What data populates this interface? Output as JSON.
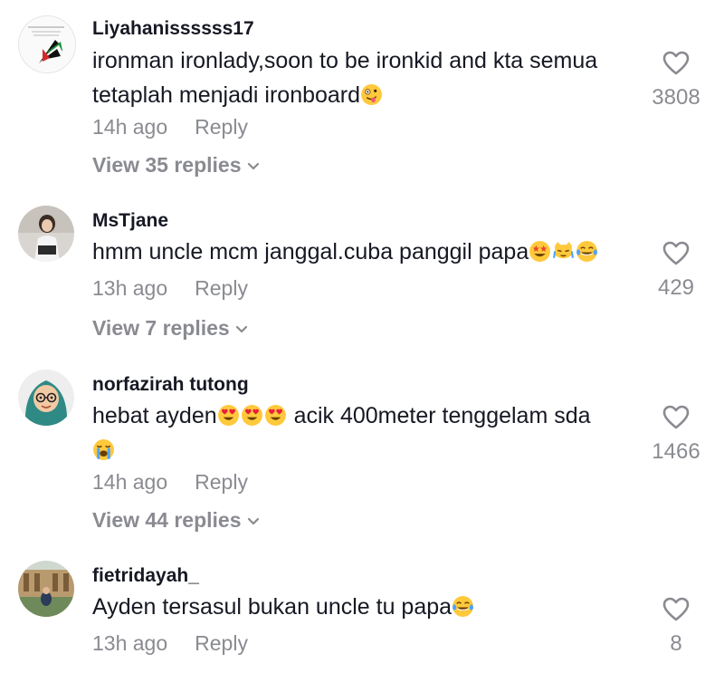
{
  "colors": {
    "text_primary": "#161823",
    "text_secondary": "#8a8b91",
    "background": "#ffffff"
  },
  "comments": [
    {
      "username": "Liyahanissssss17",
      "text_lines": [
        "ironman ironlady,soon to be ironkid and kta semua",
        "tetaplah menjadi ironboard"
      ],
      "emojis": [
        "zany-face-emoji"
      ],
      "time": "14h ago",
      "reply_label": "Reply",
      "view_replies": "View 35 replies",
      "likes": "3808",
      "avatar": "palestine-flag-avatar"
    },
    {
      "username": "MsTjane",
      "text_lines": [
        "hmm uncle mcm janggal.cuba panggil papa"
      ],
      "emojis": [
        "star-struck-emoji",
        "crying-cat-emoji",
        "joy-emoji"
      ],
      "time": "13h ago",
      "reply_label": "Reply",
      "view_replies": "View 7 replies",
      "likes": "429",
      "avatar": "photo-avatar"
    },
    {
      "username": "norfazirah tutong",
      "text_lines": [
        "hebat ayden",
        " acik 400meter tenggelam sda"
      ],
      "emojis": [
        "heart-eyes-emoji",
        "heart-eyes-emoji",
        "heart-eyes-emoji",
        "loudly-crying-emoji"
      ],
      "time": "14h ago",
      "reply_label": "Reply",
      "view_replies": "View 44 replies",
      "likes": "1466",
      "avatar": "hijab-cartoon-avatar"
    },
    {
      "username": "fietridayah_",
      "text_lines": [
        "Ayden tersasul bukan uncle tu papa"
      ],
      "emojis": [
        "joy-emoji"
      ],
      "time": "13h ago",
      "reply_label": "Reply",
      "likes": "8",
      "avatar": "photo-avatar"
    }
  ]
}
